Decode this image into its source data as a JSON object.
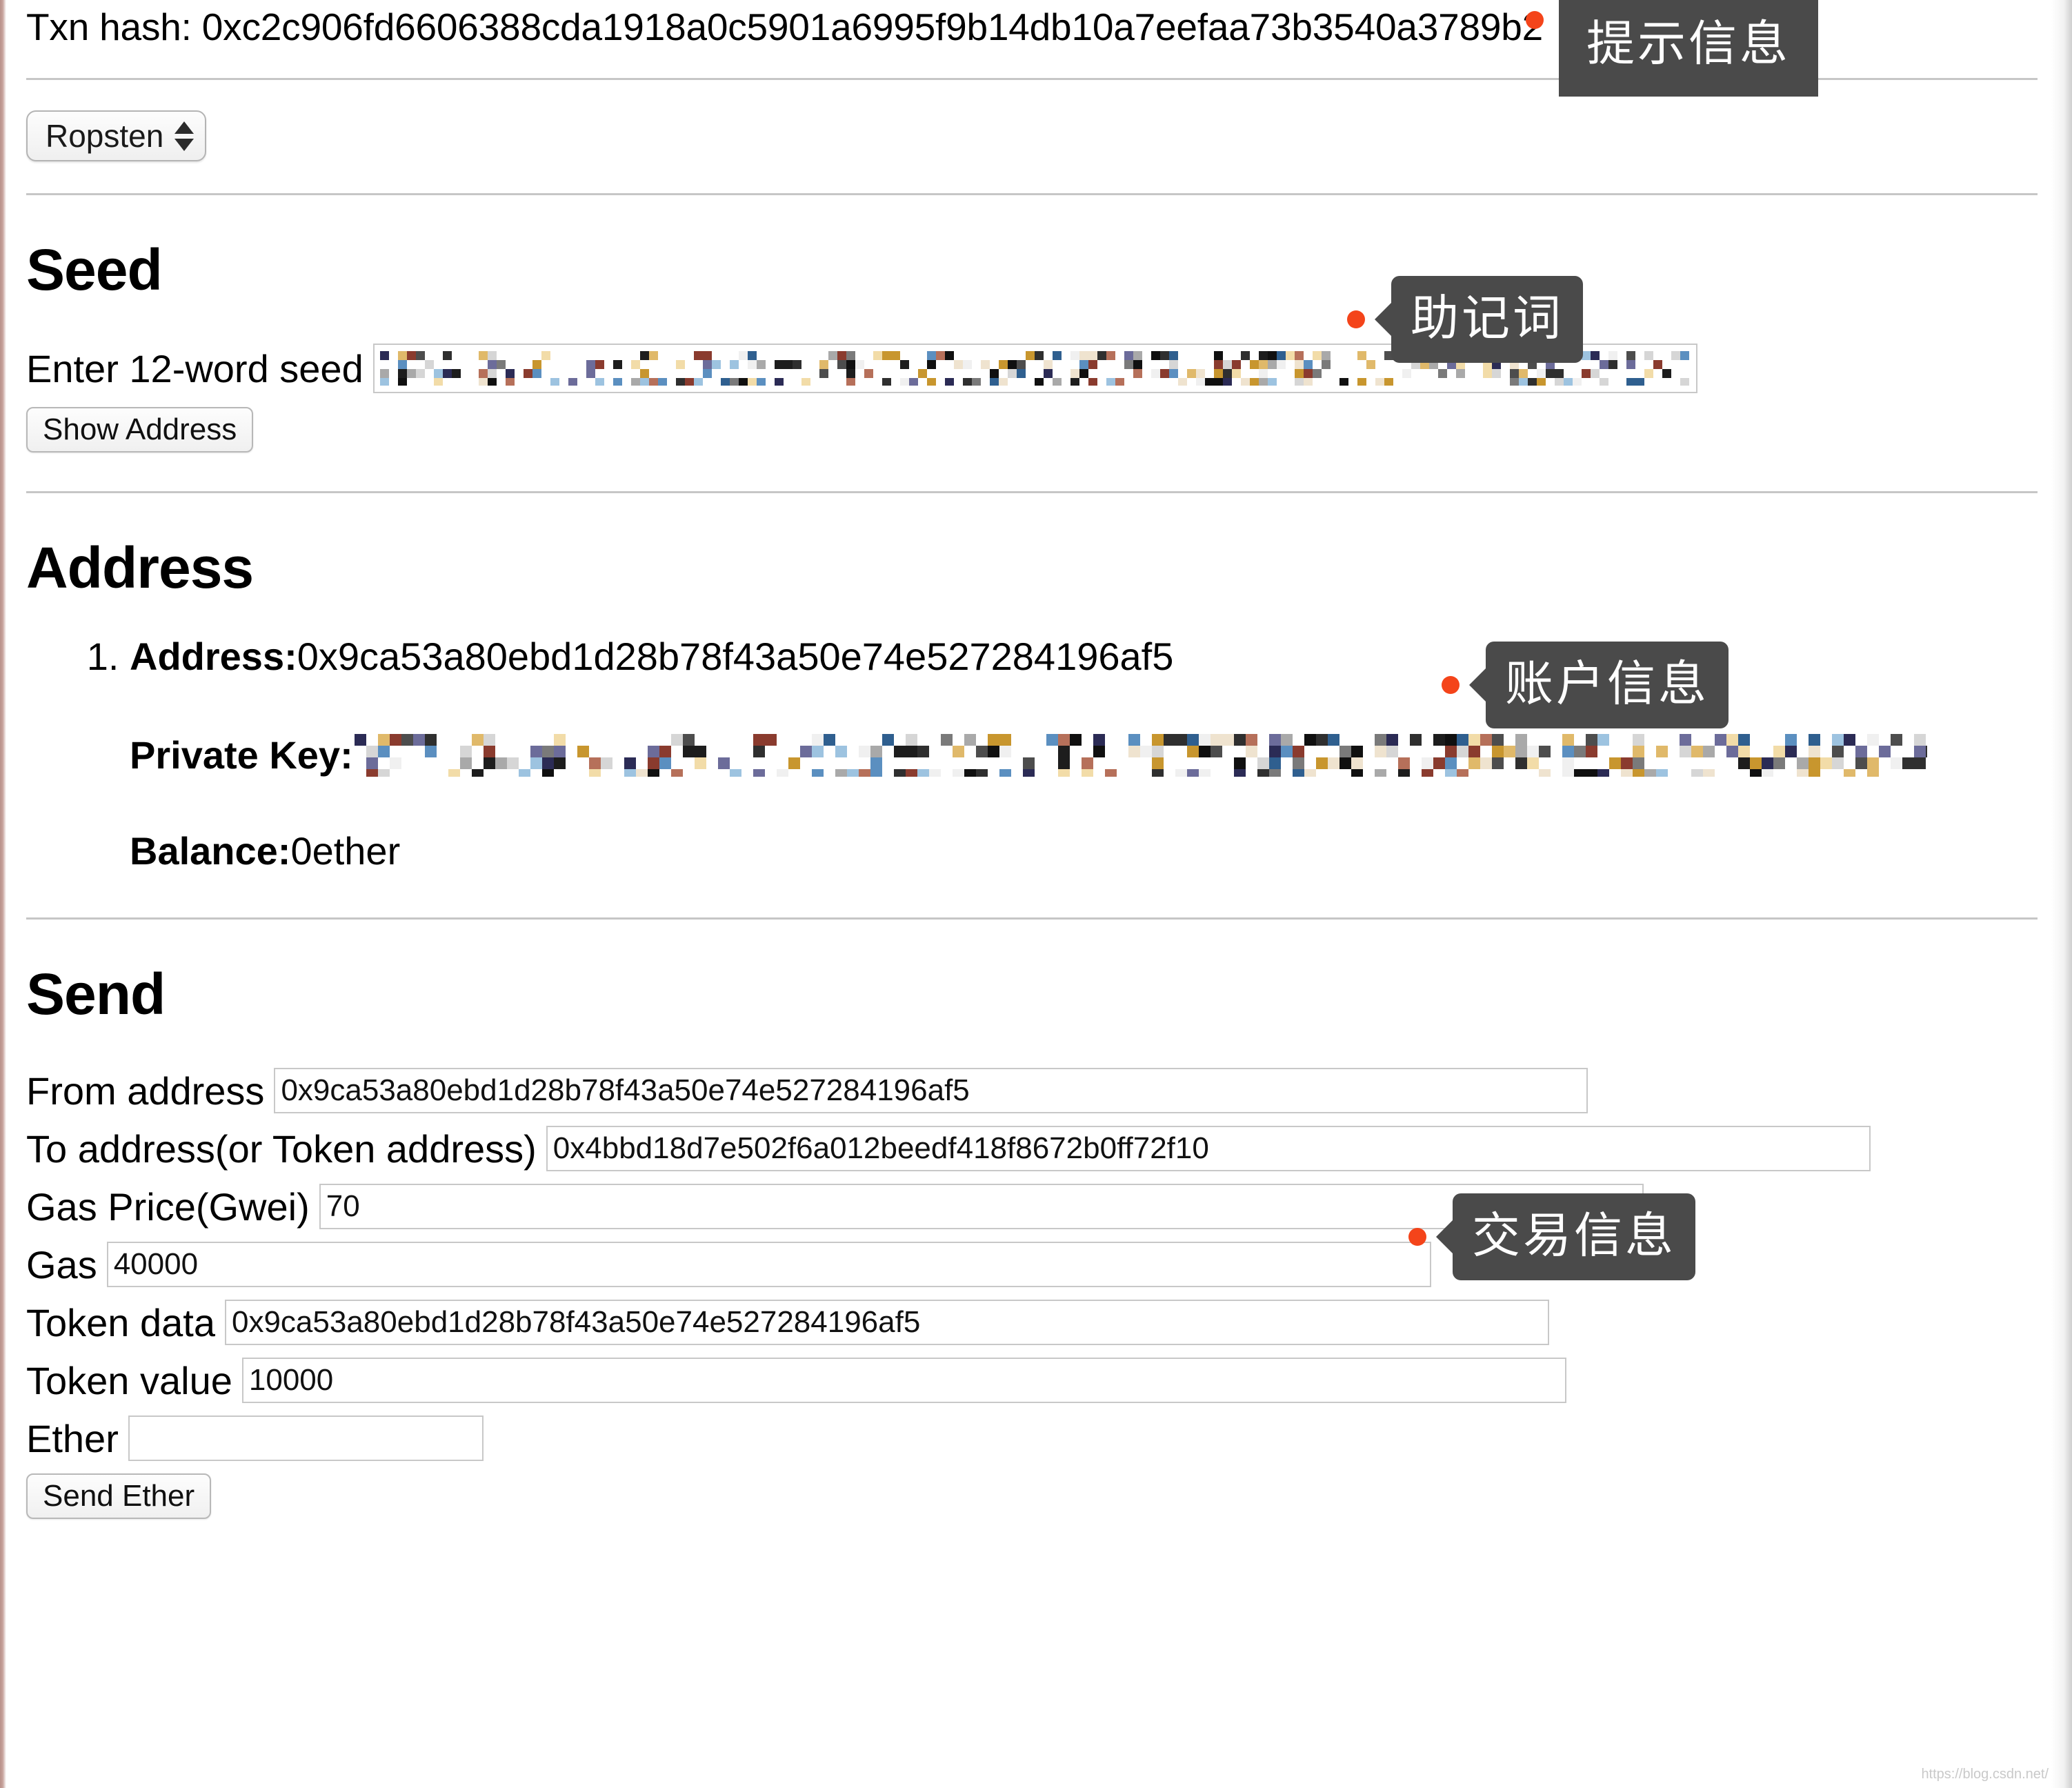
{
  "txn": {
    "label": "Txn hash: ",
    "hash": "0xc2c906fd6606388cda1918a0c5901a6995f9b14db10a7eefaa73b3540a3789b2"
  },
  "network_select": {
    "value": "Ropsten",
    "stepper_icon": "stepper-updown-icon"
  },
  "seed": {
    "heading": "Seed",
    "input_label": "Enter 12-word seed",
    "input_value": "",
    "input_redacted": true,
    "show_address_button": "Show Address"
  },
  "address": {
    "heading": "Address",
    "items": [
      {
        "index": "1.",
        "address_label": "Address:",
        "address_value": "0x9ca53a80ebd1d28b78f43a50e74e527284196af5",
        "private_key_label": "Private Key:",
        "private_key_value": "",
        "private_key_redacted": true,
        "balance_label": "Balance:",
        "balance_value": "0ether"
      }
    ]
  },
  "send": {
    "heading": "Send",
    "fields": [
      {
        "label": "From address",
        "value": "0x9ca53a80ebd1d28b78f43a50e74e527284196af5",
        "placeholder": ""
      },
      {
        "label": "To address(or Token address)",
        "value": "0x4bbd18d7e502f6a012beedf418f8672b0ff72f10",
        "placeholder": ""
      },
      {
        "label": "Gas Price(Gwei)",
        "value": "70",
        "placeholder": ""
      },
      {
        "label": "Gas",
        "value": "40000",
        "placeholder": ""
      },
      {
        "label": "Token data",
        "value": "0x9ca53a80ebd1d28b78f43a50e74e527284196af5",
        "placeholder": ""
      },
      {
        "label": "Token value",
        "value": "10000",
        "placeholder": ""
      },
      {
        "label": "Ether",
        "value": "",
        "placeholder": ""
      }
    ],
    "send_button": "Send Ether"
  },
  "tooltips": [
    {
      "text": "提示信息",
      "name": "tooltip-hint-info"
    },
    {
      "text": "助记词",
      "name": "tooltip-mnemonic"
    },
    {
      "text": "账户信息",
      "name": "tooltip-account-info"
    },
    {
      "text": "交易信息",
      "name": "tooltip-transaction-info"
    }
  ],
  "colors": {
    "tooltip_bg": "#4a4a4a",
    "tooltip_dot": "#f4441a",
    "rule": "#c6c6c6",
    "input_border": "#c8c8c8"
  },
  "watermark": "https://blog.csdn.net/"
}
